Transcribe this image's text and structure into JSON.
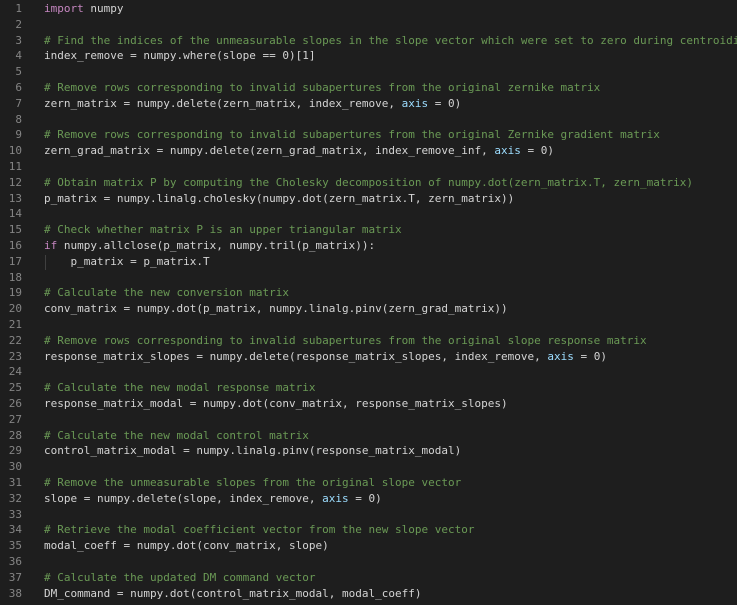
{
  "colors": {
    "background": "#1e1e1e",
    "line_number": "#858585",
    "default": "#d4d4d4",
    "comment": "#6a9955",
    "keyword": "#c586c0",
    "parameter": "#9cdcfe"
  },
  "lines": [
    {
      "n": "1",
      "segments": [
        {
          "t": "import",
          "c": "keyword"
        },
        {
          "t": " numpy",
          "c": "default"
        }
      ]
    },
    {
      "n": "2",
      "segments": []
    },
    {
      "n": "3",
      "segments": [
        {
          "t": "# Find the indices of the unmeasurable slopes in the slope vector which were set to zero during centroiding",
          "c": "comment"
        }
      ]
    },
    {
      "n": "4",
      "segments": [
        {
          "t": "index_remove = numpy.where(slope == 0)[1]",
          "c": "default"
        }
      ]
    },
    {
      "n": "5",
      "segments": []
    },
    {
      "n": "6",
      "segments": [
        {
          "t": "# Remove rows corresponding to invalid subapertures from the original zernike matrix",
          "c": "comment"
        }
      ]
    },
    {
      "n": "7",
      "segments": [
        {
          "t": "zern_matrix = numpy.delete(zern_matrix, index_remove, ",
          "c": "default"
        },
        {
          "t": "axis",
          "c": "parameter"
        },
        {
          "t": " = 0)",
          "c": "default"
        }
      ]
    },
    {
      "n": "8",
      "segments": []
    },
    {
      "n": "9",
      "segments": [
        {
          "t": "# Remove rows corresponding to invalid subapertures from the original Zernike gradient matrix",
          "c": "comment"
        }
      ]
    },
    {
      "n": "10",
      "segments": [
        {
          "t": "zern_grad_matrix = numpy.delete(zern_grad_matrix, index_remove_inf, ",
          "c": "default"
        },
        {
          "t": "axis",
          "c": "parameter"
        },
        {
          "t": " = 0)",
          "c": "default"
        }
      ]
    },
    {
      "n": "11",
      "segments": []
    },
    {
      "n": "12",
      "segments": [
        {
          "t": "# Obtain matrix P by computing the Cholesky decomposition of numpy.dot(zern_matrix.T, zern_matrix)",
          "c": "comment"
        }
      ]
    },
    {
      "n": "13",
      "segments": [
        {
          "t": "p_matrix = numpy.linalg.cholesky(numpy.dot(zern_matrix.T, zern_matrix))",
          "c": "default"
        }
      ]
    },
    {
      "n": "14",
      "segments": []
    },
    {
      "n": "15",
      "segments": [
        {
          "t": "# Check whether matrix P is an upper triangular matrix",
          "c": "comment"
        }
      ]
    },
    {
      "n": "16",
      "segments": [
        {
          "t": "if",
          "c": "keyword"
        },
        {
          "t": " numpy.allclose(p_matrix, numpy.tril(p_matrix)):",
          "c": "default"
        }
      ]
    },
    {
      "n": "17",
      "segments": [
        {
          "t": "    p_matrix = p_matrix.T",
          "c": "default"
        }
      ]
    },
    {
      "n": "18",
      "segments": []
    },
    {
      "n": "19",
      "segments": [
        {
          "t": "# Calculate the new conversion matrix",
          "c": "comment"
        }
      ]
    },
    {
      "n": "20",
      "segments": [
        {
          "t": "conv_matrix = numpy.dot(p_matrix, numpy.linalg.pinv(zern_grad_matrix))",
          "c": "default"
        }
      ]
    },
    {
      "n": "21",
      "segments": []
    },
    {
      "n": "22",
      "segments": [
        {
          "t": "# Remove rows corresponding to invalid subapertures from the original slope response matrix",
          "c": "comment"
        }
      ]
    },
    {
      "n": "23",
      "segments": [
        {
          "t": "response_matrix_slopes = numpy.delete(response_matrix_slopes, index_remove, ",
          "c": "default"
        },
        {
          "t": "axis",
          "c": "parameter"
        },
        {
          "t": " = 0)",
          "c": "default"
        }
      ]
    },
    {
      "n": "24",
      "segments": []
    },
    {
      "n": "25",
      "segments": [
        {
          "t": "# Calculate the new modal response matrix",
          "c": "comment"
        }
      ]
    },
    {
      "n": "26",
      "segments": [
        {
          "t": "response_matrix_modal = numpy.dot(conv_matrix, response_matrix_slopes)",
          "c": "default"
        }
      ]
    },
    {
      "n": "27",
      "segments": []
    },
    {
      "n": "28",
      "segments": [
        {
          "t": "# Calculate the new modal control matrix",
          "c": "comment"
        }
      ]
    },
    {
      "n": "29",
      "segments": [
        {
          "t": "control_matrix_modal = numpy.linalg.pinv(response_matrix_modal)",
          "c": "default"
        }
      ]
    },
    {
      "n": "30",
      "segments": []
    },
    {
      "n": "31",
      "segments": [
        {
          "t": "# Remove the unmeasurable slopes from the original slope vector",
          "c": "comment"
        }
      ]
    },
    {
      "n": "32",
      "segments": [
        {
          "t": "slope = numpy.delete(slope, index_remove, ",
          "c": "default"
        },
        {
          "t": "axis",
          "c": "parameter"
        },
        {
          "t": " = 0)",
          "c": "default"
        }
      ]
    },
    {
      "n": "33",
      "segments": []
    },
    {
      "n": "34",
      "segments": [
        {
          "t": "# Retrieve the modal coefficient vector from the new slope vector",
          "c": "comment"
        }
      ]
    },
    {
      "n": "35",
      "segments": [
        {
          "t": "modal_coeff = numpy.dot(conv_matrix, slope)",
          "c": "default"
        }
      ]
    },
    {
      "n": "36",
      "segments": []
    },
    {
      "n": "37",
      "segments": [
        {
          "t": "# Calculate the updated DM command vector",
          "c": "comment"
        }
      ]
    },
    {
      "n": "38",
      "segments": [
        {
          "t": "DM_command = numpy.dot(control_matrix_modal, modal_coeff)",
          "c": "default"
        }
      ]
    }
  ]
}
